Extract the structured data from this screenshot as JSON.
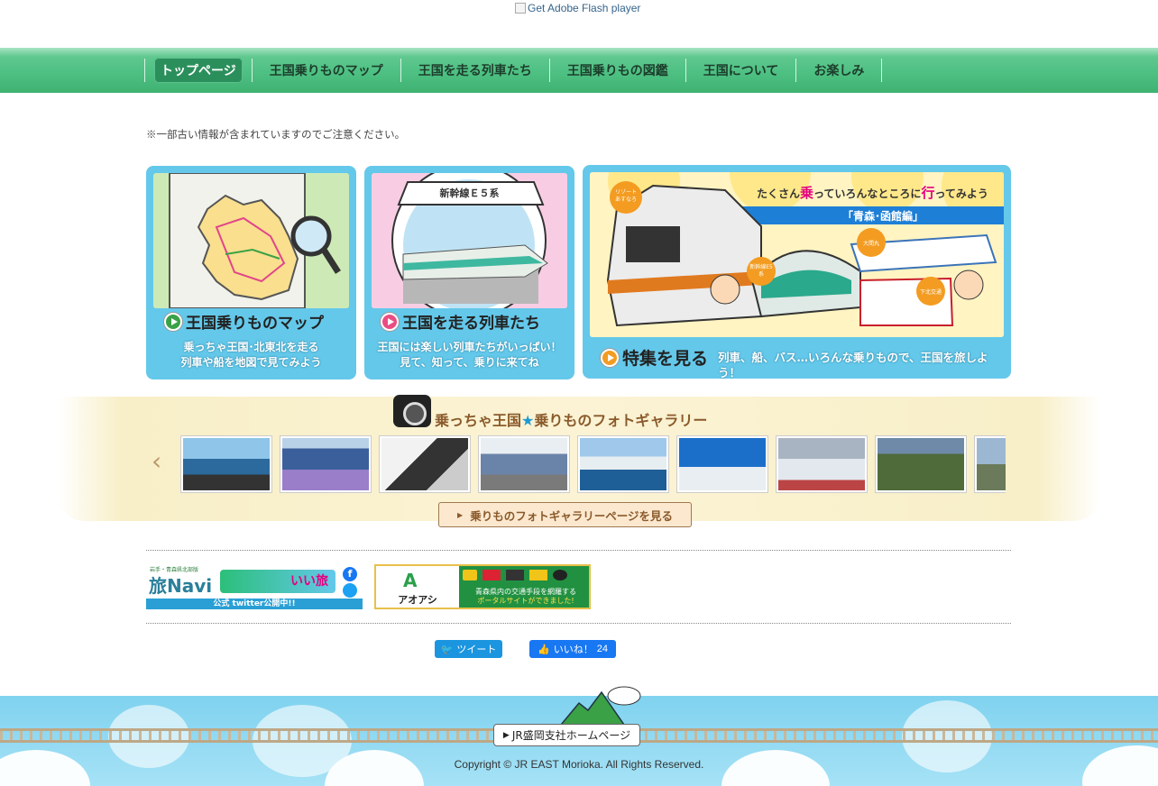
{
  "flash": {
    "alt": "Get Adobe Flash player"
  },
  "nav": {
    "items": [
      {
        "label": "トップページ"
      },
      {
        "label": "王国乗りものマップ"
      },
      {
        "label": "王国を走る列車たち"
      },
      {
        "label": "王国乗りもの図鑑"
      },
      {
        "label": "王国について"
      },
      {
        "label": "お楽しみ"
      }
    ]
  },
  "notice": "※一部古い情報が含まれていますのでご注意ください。",
  "cards": {
    "map": {
      "title": "王国乗りものマップ",
      "desc1": "乗っちゃ王国･北東北を走る",
      "desc2": "列車や船を地図で見てみよう"
    },
    "trains": {
      "banner": "新幹線Ｅ５系",
      "title": "王国を走る列車たち",
      "desc1": "王国には楽しい列車たちがいっぱい！",
      "desc2": "見て、知って、乗りに来てね"
    },
    "feature": {
      "headline_pre": "たくさん",
      "headline_em1": "乗",
      "headline_mid": "っていろんなところに",
      "headline_em2": "行",
      "headline_post": "ってみよう",
      "sub": "「青森･函館編」",
      "badge1": "リゾートあすなろ",
      "badge2": "大間丸",
      "badge3": "新幹線E5系",
      "badge4": "下北交通",
      "title": "特集を見る",
      "desc": "列車、船、バス…いろんな乗りもので、王国を旅しよう！"
    }
  },
  "gallery": {
    "title_pre": "乗っちゃ王国",
    "title_star": "★",
    "title_post": "乗りものフォトギャラリー",
    "prev_arrow": "‹",
    "next_arrow": "›",
    "button": "乗りものフォトギャラリーページを見る"
  },
  "banners": {
    "tabinavi": {
      "small": "岩手・青森県北部版",
      "brand": "旅Navi",
      "tag": "いい旅",
      "note": "公式 twitter公開中!!"
    },
    "aoashi": {
      "name": "アオアシ",
      "desc1": "青森県内の交通手段を網羅する",
      "desc2": "ポータルサイトができました!"
    }
  },
  "social": {
    "tweet": "ツイート",
    "like": "いいね！",
    "like_count": "24"
  },
  "footer": {
    "jr_link": "JR盛岡支社ホームページ",
    "copyright": "Copyright © JR EAST Morioka. All Rights Reserved."
  },
  "colors": {
    "nav_green": "#4cbf81",
    "card_blue": "#64c8ea",
    "gallery_brown": "#8a5a2b",
    "footer_sky": "#7fd2ef"
  }
}
